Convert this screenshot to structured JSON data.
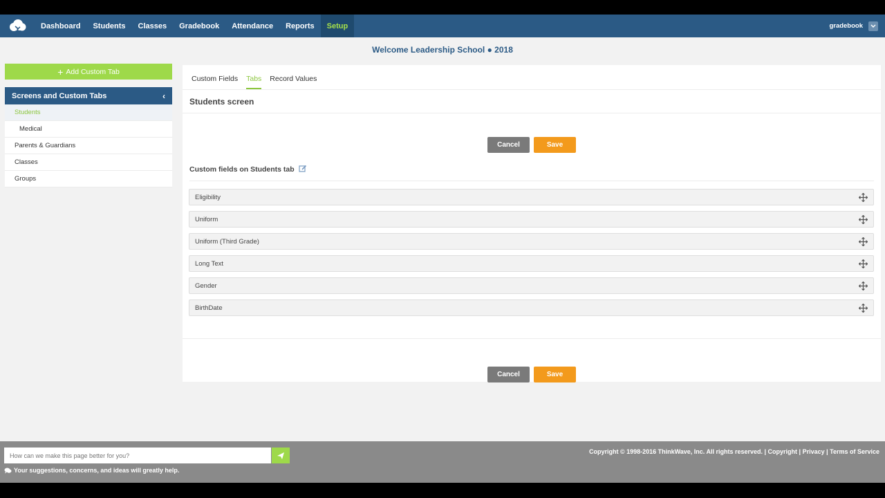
{
  "nav": {
    "items": [
      {
        "label": "Dashboard"
      },
      {
        "label": "Students"
      },
      {
        "label": "Classes"
      },
      {
        "label": "Gradebook"
      },
      {
        "label": "Attendance"
      },
      {
        "label": "Reports"
      },
      {
        "label": "Setup",
        "active": true
      }
    ],
    "user": "gradebook"
  },
  "school_title": "Welcome Leadership School  ● 2018",
  "sidebar": {
    "add_button": "Add Custom Tab",
    "header": "Screens and Custom Tabs",
    "items": [
      {
        "label": "Students",
        "active": true
      },
      {
        "label": "Medical",
        "sub": true
      },
      {
        "label": "Parents & Guardians"
      },
      {
        "label": "Classes"
      },
      {
        "label": "Groups"
      }
    ]
  },
  "tabs": [
    "Custom Fields",
    "Tabs",
    "Record Values"
  ],
  "active_tab": "Tabs",
  "screen_title": "Students screen",
  "buttons": {
    "cancel": "Cancel",
    "save": "Save"
  },
  "custom_fields_heading": "Custom fields on Students tab",
  "fields": [
    "Eligibility",
    "Uniform",
    "Uniform (Third Grade)",
    "Long Text",
    "Gender",
    "BirthDate"
  ],
  "footer": {
    "feedback_placeholder": "How can we make this page better for you?",
    "note": "Your suggestions, concerns, and ideas will greatly help.",
    "copyright": "Copyright © 1998-2016 ThinkWave, Inc. All rights reserved.",
    "links": [
      "Copyright",
      "Privacy",
      "Terms of Service"
    ]
  },
  "colors": {
    "nav": "#2b5a85",
    "accent_green": "#9ed94a",
    "save_orange": "#f39a1c",
    "cancel_gray": "#7a7a7a"
  },
  "icons": [
    "cloud-logo-icon",
    "chevron-down-icon",
    "plus-icon",
    "chevron-left-icon",
    "edit-icon",
    "move-icon",
    "send-icon",
    "comments-icon"
  ]
}
